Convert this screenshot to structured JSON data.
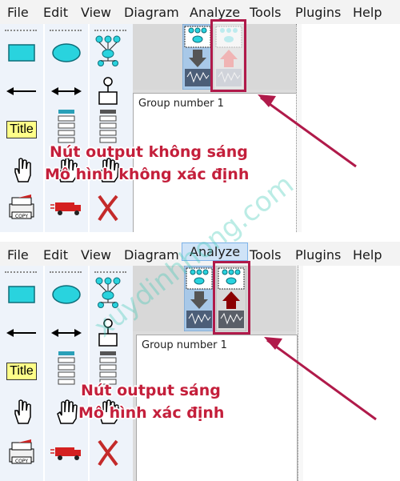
{
  "menu": {
    "file": "File",
    "edit": "Edit",
    "view": "View",
    "diagram": "Diagram",
    "analyze": "Analyze",
    "tools": "Tools",
    "plugins": "Plugins",
    "help": "Help"
  },
  "palette": {
    "title_label": "Title"
  },
  "group_label": "Group number 1",
  "top": {
    "caption_line1": "Nút output không sáng",
    "caption_line2": "Mô hình không xác định",
    "output_enabled": false
  },
  "bottom": {
    "caption_line1": "Nút output sáng",
    "caption_line2": "Mô hình xác định",
    "output_enabled": true,
    "analyze_menu_active": true
  },
  "watermark": "xuydinhhong.com",
  "colors": {
    "highlight": "#b01a4a",
    "caption": "#c41f3b",
    "arrow_enabled": "#8b0000",
    "arrow_disabled": "#f0b4b4",
    "shape_fill": "#29d3de"
  }
}
